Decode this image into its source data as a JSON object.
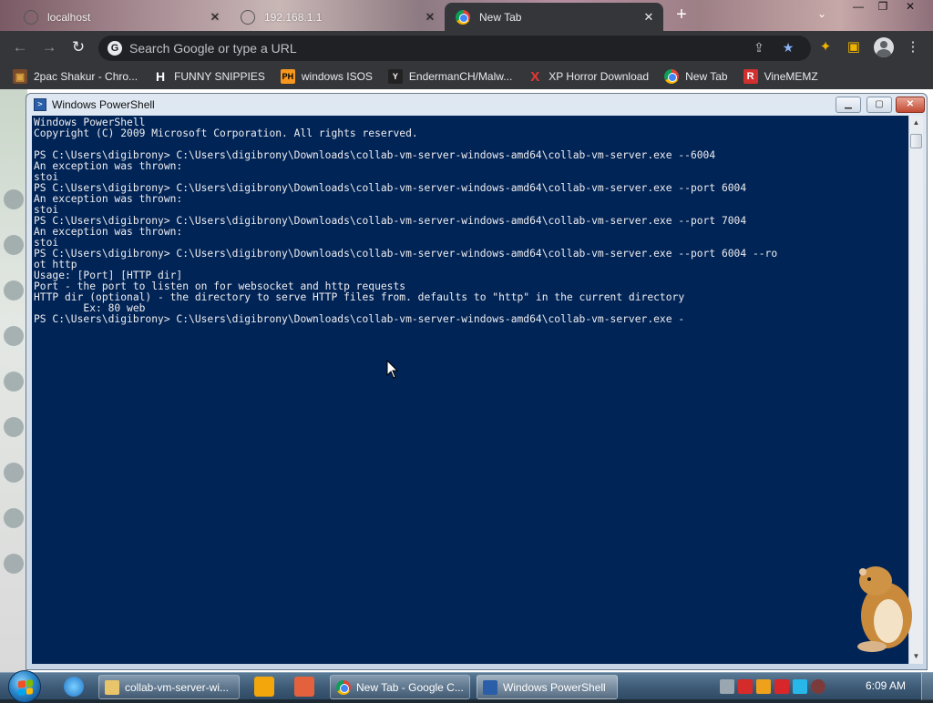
{
  "browser": {
    "tabs": [
      {
        "title": "localhost",
        "active": false
      },
      {
        "title": "192.168.1.1",
        "active": false
      },
      {
        "title": "New Tab",
        "active": true
      }
    ],
    "omnibox": {
      "placeholder": "Search Google or type a URL"
    },
    "bookmarks": [
      {
        "label": "2pac Shakur - Chro...",
        "icon": "shopping-bag-icon",
        "color": "#d9a441"
      },
      {
        "label": "FUNNY SNIPPIES",
        "icon": "h-logo-icon",
        "color": "#ffffff"
      },
      {
        "label": "windows ISOS",
        "icon": "ph-logo-icon",
        "color": "#f7971d"
      },
      {
        "label": "EndermanCH/Malw...",
        "icon": "yp-logo-icon",
        "color": "#ffffff"
      },
      {
        "label": "XP Horror Download",
        "icon": "x-logo-icon",
        "color": "#e53935"
      },
      {
        "label": "New Tab",
        "icon": "chrome-icon",
        "color": "#4285f4"
      },
      {
        "label": "VineMEMZ",
        "icon": "r-logo-icon",
        "color": "#d32f2f"
      }
    ]
  },
  "powershell": {
    "title": "Windows PowerShell",
    "lines": [
      "Windows PowerShell",
      "Copyright (C) 2009 Microsoft Corporation. All rights reserved.",
      "",
      "PS C:\\Users\\digibrony> C:\\Users\\digibrony\\Downloads\\collab-vm-server-windows-amd64\\collab-vm-server.exe --6004",
      "An exception was thrown:",
      "stoi",
      "PS C:\\Users\\digibrony> C:\\Users\\digibrony\\Downloads\\collab-vm-server-windows-amd64\\collab-vm-server.exe --port 6004",
      "An exception was thrown:",
      "stoi",
      "PS C:\\Users\\digibrony> C:\\Users\\digibrony\\Downloads\\collab-vm-server-windows-amd64\\collab-vm-server.exe --port 7004",
      "An exception was thrown:",
      "stoi",
      "PS C:\\Users\\digibrony> C:\\Users\\digibrony\\Downloads\\collab-vm-server-windows-amd64\\collab-vm-server.exe --port 6004 --ro",
      "ot http",
      "Usage: [Port] [HTTP dir]",
      "Port - the port to listen on for websocket and http requests",
      "HTTP dir (optional) - the directory to serve HTTP files from. defaults to \"http\" in the current directory",
      "        Ex: 80 web",
      "PS C:\\Users\\digibrony> C:\\Users\\digibrony\\Downloads\\collab-vm-server-windows-amd64\\collab-vm-server.exe -"
    ],
    "colors": {
      "background": "#012456",
      "foreground": "#eeedf0"
    }
  },
  "taskbar": {
    "items": [
      {
        "label": "collab-vm-server-wi...",
        "icon": "folder-icon",
        "active": false
      },
      {
        "label": "New Tab - Google C...",
        "icon": "chrome-icon",
        "active": false
      },
      {
        "label": "Windows PowerShell",
        "icon": "powershell-icon",
        "active": true
      }
    ],
    "clock": "6:09 AM"
  }
}
